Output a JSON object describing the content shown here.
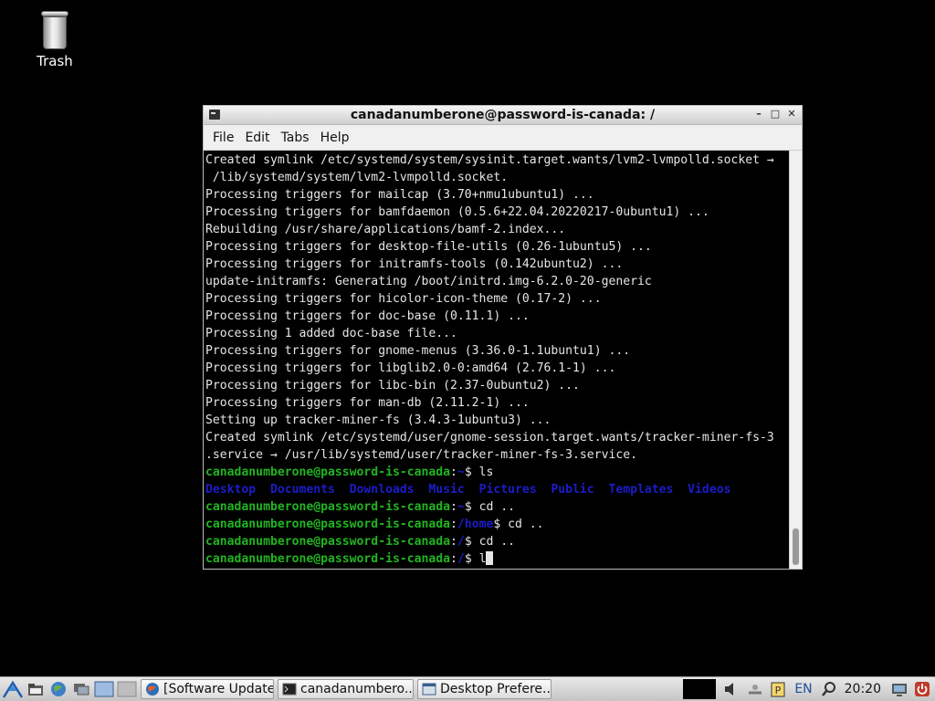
{
  "desktop": {
    "trash_label": "Trash"
  },
  "window": {
    "title": "canadanumberone@password-is-canada: /",
    "controls": {
      "minimize": "–",
      "maximize": "□",
      "close": "✕"
    },
    "menu": [
      "File",
      "Edit",
      "Tabs",
      "Help"
    ]
  },
  "terminal": {
    "output": [
      "Created symlink /etc/systemd/system/sysinit.target.wants/lvm2-lvmpolld.socket →",
      " /lib/systemd/system/lvm2-lvmpolld.socket.",
      "Processing triggers for mailcap (3.70+nmu1ubuntu1) ...",
      "Processing triggers for bamfdaemon (0.5.6+22.04.20220217-0ubuntu1) ...",
      "Rebuilding /usr/share/applications/bamf-2.index...",
      "Processing triggers for desktop-file-utils (0.26-1ubuntu5) ...",
      "Processing triggers for initramfs-tools (0.142ubuntu2) ...",
      "update-initramfs: Generating /boot/initrd.img-6.2.0-20-generic",
      "Processing triggers for hicolor-icon-theme (0.17-2) ...",
      "Processing triggers for doc-base (0.11.1) ...",
      "Processing 1 added doc-base file...",
      "Processing triggers for gnome-menus (3.36.0-1.1ubuntu1) ...",
      "Processing triggers for libglib2.0-0:amd64 (2.76.1-1) ...",
      "Processing triggers for libc-bin (2.37-0ubuntu2) ...",
      "Processing triggers for man-db (2.11.2-1) ...",
      "Setting up tracker-miner-fs (3.4.3-1ubuntu3) ...",
      "Created symlink /etc/systemd/user/gnome-session.target.wants/tracker-miner-fs-3",
      ".service → /usr/lib/systemd/user/tracker-miner-fs-3.service."
    ],
    "prompt_user": "canadanumberone@password-is-canada",
    "prompts": [
      {
        "path": "~",
        "command": "ls"
      },
      {
        "path": "~",
        "command": "cd .."
      },
      {
        "path": "/home",
        "command": "cd .."
      },
      {
        "path": "/",
        "command": "cd .."
      },
      {
        "path": "/",
        "command": "l"
      }
    ],
    "ls_listing": "Desktop  Documents  Downloads  Music  Pictures  Public  Templates  Videos"
  },
  "taskbar": {
    "tasks": [
      {
        "label": "[Software Updater]",
        "icon": "globe-icon"
      },
      {
        "label": "canadanumbero...",
        "icon": "terminal-icon"
      },
      {
        "label": "Desktop Prefere...",
        "icon": "window-icon"
      }
    ],
    "keyboard_layout": "EN",
    "clock": "20:20"
  },
  "colors": {
    "prompt_user": "#22b422",
    "prompt_path": "#1c1cc8",
    "directory": "#1c1cc8"
  }
}
